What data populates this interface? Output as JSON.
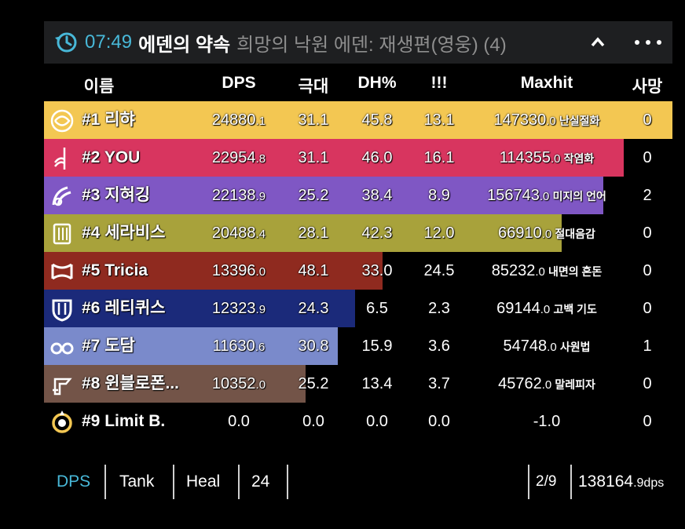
{
  "title": {
    "time": "07:49",
    "zone": "에덴의 약속",
    "encounter": "희망의 낙원 에덴: 재생편(영웅) (4)"
  },
  "columns": [
    "이름",
    "DPS",
    "극대",
    "DH%",
    "!!!",
    "Maxhit",
    "사망"
  ],
  "players": [
    {
      "rank": "#1",
      "name": "리햐",
      "dps_int": "24880",
      "dps_dec": ".1",
      "crit": "31.1",
      "dh": "45.8",
      "cdh": "13.1",
      "maxhit_int": "147330",
      "maxhit_dec": ".0",
      "maxhit_skill": "난실절화",
      "deaths": "0",
      "color": "#f3c752",
      "fill": 1.0,
      "icon": "samurai-icon"
    },
    {
      "rank": "#2",
      "name": "YOU",
      "dps_int": "22954",
      "dps_dec": ".8",
      "crit": "31.1",
      "dh": "46.0",
      "cdh": "16.1",
      "maxhit_int": "114355",
      "maxhit_dec": ".0",
      "maxhit_skill": "작염화",
      "deaths": "0",
      "color": "#d8355f",
      "fill": 0.9226,
      "icon": "red-mage-icon"
    },
    {
      "rank": "#3",
      "name": "지혀깅",
      "dps_int": "22138",
      "dps_dec": ".9",
      "crit": "25.2",
      "dh": "38.4",
      "cdh": "8.9",
      "maxhit_int": "156743",
      "maxhit_dec": ".0",
      "maxhit_skill": "미지의 언어",
      "deaths": "2",
      "color": "#7f57c4",
      "fill": 0.8898,
      "icon": "summoner-icon"
    },
    {
      "rank": "#4",
      "name": "세라비스",
      "dps_int": "20488",
      "dps_dec": ".4",
      "crit": "28.1",
      "dh": "42.3",
      "cdh": "12.0",
      "maxhit_int": "66910",
      "maxhit_dec": ".0",
      "maxhit_skill": "절대음감",
      "deaths": "0",
      "color": "#a8a23b",
      "fill": 0.8235,
      "icon": "bard-icon"
    },
    {
      "rank": "#5",
      "name": "Tricia",
      "dps_int": "13396",
      "dps_dec": ".0",
      "crit": "48.1",
      "dh": "33.0",
      "cdh": "24.5",
      "maxhit_int": "85232",
      "maxhit_dec": ".0",
      "maxhit_skill": "내면의 혼돈",
      "deaths": "0",
      "color": "#8f2a1f",
      "fill": 0.5384,
      "icon": "warrior-icon"
    },
    {
      "rank": "#6",
      "name": "레티퀴스",
      "dps_int": "12323",
      "dps_dec": ".9",
      "crit": "24.3",
      "dh": "6.5",
      "cdh": "2.3",
      "maxhit_int": "69144",
      "maxhit_dec": ".0",
      "maxhit_skill": "고백 기도",
      "deaths": "0",
      "color": "#1b2a7a",
      "fill": 0.4953,
      "icon": "paladin-icon"
    },
    {
      "rank": "#7",
      "name": "도담",
      "dps_int": "11630",
      "dps_dec": ".6",
      "crit": "30.8",
      "dh": "15.9",
      "cdh": "3.6",
      "maxhit_int": "54748",
      "maxhit_dec": ".0",
      "maxhit_skill": "사원법",
      "deaths": "1",
      "color": "#7a8acb",
      "fill": 0.4675,
      "icon": "astrologian-icon"
    },
    {
      "rank": "#8",
      "name": "윈블로폰...",
      "dps_int": "10352",
      "dps_dec": ".0",
      "crit": "25.2",
      "dh": "13.4",
      "cdh": "3.7",
      "maxhit_int": "45762",
      "maxhit_dec": ".0",
      "maxhit_skill": "말레피자",
      "deaths": "0",
      "color": "#735448",
      "fill": 0.4161,
      "icon": "scholar-icon"
    },
    {
      "rank": "#9",
      "name": "Limit B.",
      "dps_int": "0.0",
      "dps_dec": "",
      "crit": "0.0",
      "dh": "0.0",
      "cdh": "0.0",
      "maxhit_int": "-1.0",
      "maxhit_dec": "",
      "maxhit_skill": "",
      "deaths": "0",
      "color": "#000000",
      "fill": 0.0,
      "icon": "limit-break-icon"
    }
  ],
  "footer": {
    "tabs": [
      "DPS",
      "Tank",
      "Heal",
      "24"
    ],
    "active_tab_color": "#48b8d8",
    "rank": "2/9",
    "total_int": "138164",
    "total_dec": ".9dps"
  }
}
